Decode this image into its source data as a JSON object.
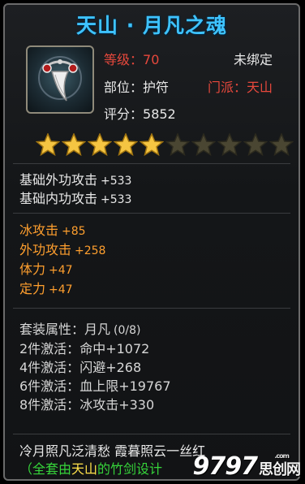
{
  "item": {
    "name": "天山 · 月凡之魂",
    "level_label": "等级：",
    "level_value": "70",
    "bind_status": "未绑定",
    "slot_label": "部位：",
    "slot_value": "护符",
    "school_label": "门派：",
    "school_value": "天山",
    "score_label": "评分：",
    "score_value": "5852",
    "stars_filled": 5,
    "stars_total": 10
  },
  "base_stats": [
    {
      "label": "基础外功攻击",
      "value": "+533"
    },
    {
      "label": "基础内功攻击",
      "value": "+533"
    }
  ],
  "extra_stats": [
    {
      "label": "冰攻击",
      "value": "+85"
    },
    {
      "label": "外功攻击",
      "value": "+258"
    },
    {
      "label": "体力",
      "value": "+47"
    },
    {
      "label": "定力",
      "value": "+47"
    }
  ],
  "set": {
    "header_label": "套装属性：",
    "set_name": "月凡",
    "set_count": "(0/8)",
    "bonuses": [
      {
        "label": "2件激活：",
        "value": "命中+1072"
      },
      {
        "label": "4件激活：",
        "value": "闪避+268"
      },
      {
        "label": "6件激活：",
        "value": "血上限+19767"
      },
      {
        "label": "8件激活：",
        "value": "冰攻击+330"
      }
    ]
  },
  "flavor": {
    "poem": "冷月照凡泛清愁 霞暮照云一丝红",
    "design_prefix": "（全套由",
    "design_school": "天山",
    "design_suffix": "的竹剑设计"
  },
  "watermark": {
    "digits": "9797",
    "text": "思创网",
    "domain": ".com"
  },
  "colors": {
    "title": "#3ec3ff",
    "star_filled": "#f5c542",
    "star_empty": "#4a4632"
  }
}
